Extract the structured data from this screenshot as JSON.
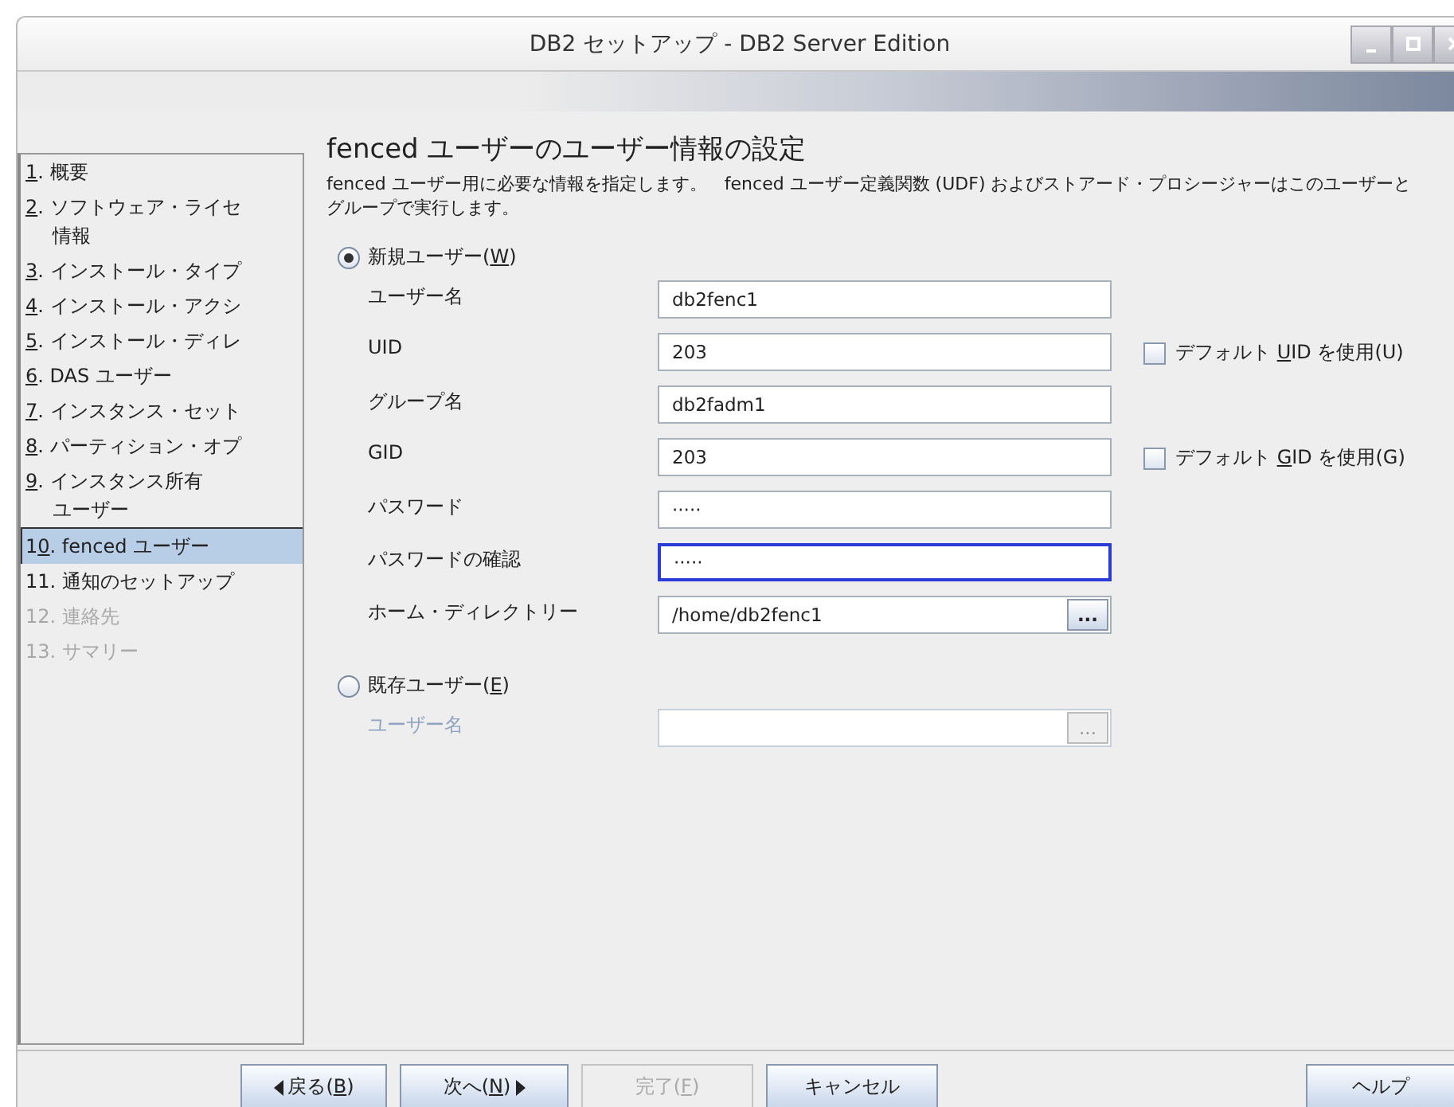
{
  "window": {
    "title": "DB2 セットアップ - DB2 Server Edition"
  },
  "steps": [
    {
      "mnemonic": "1",
      "suffix": ". 概要",
      "selected": false,
      "disabled": false
    },
    {
      "mnemonic": "2",
      "suffix": ". ソフトウェア・ライセ",
      "continuation": "情報",
      "selected": false,
      "disabled": false
    },
    {
      "mnemonic": "3",
      "suffix": ". インストール・タイプ",
      "selected": false,
      "disabled": false
    },
    {
      "mnemonic": "4",
      "suffix": ". インストール・アクシ",
      "selected": false,
      "disabled": false
    },
    {
      "mnemonic": "5",
      "suffix": ". インストール・ディレ",
      "selected": false,
      "disabled": false
    },
    {
      "mnemonic": "6",
      "suffix": ". DAS ユーザー",
      "selected": false,
      "disabled": false
    },
    {
      "mnemonic": "7",
      "suffix": ". インスタンス・セット",
      "selected": false,
      "disabled": false
    },
    {
      "mnemonic": "8",
      "suffix": ". パーティション・オプ",
      "selected": false,
      "disabled": false
    },
    {
      "mnemonic": "9",
      "suffix": ". インスタンス所有",
      "continuation": "ユーザー",
      "selected": false,
      "disabled": false
    },
    {
      "prefix": "1",
      "mnemonic": "0",
      "suffix": ". fenced ユーザー",
      "selected": true,
      "disabled": false
    },
    {
      "prefix": "11. 通知のセットアップ",
      "selected": false,
      "disabled": false
    },
    {
      "prefix": "12. 連絡先",
      "selected": false,
      "disabled": true
    },
    {
      "prefix": "13. サマリー",
      "selected": false,
      "disabled": true
    }
  ],
  "panel": {
    "heading": "fenced ユーザーのユーザー情報の設定",
    "description": "fenced ユーザー用に必要な情報を指定します。　fenced ユーザー定義関数 (UDF) およびストアード・プロシージャーはこのユーザーとグループで実行します。",
    "options": [
      {
        "prefix": "新規ユーザー(",
        "mnemonic": "W",
        "suffix": ")",
        "selected": true,
        "fields": [
          {
            "kind": "text",
            "label": "ユーザー名",
            "value": "db2fenc1",
            "focused": false,
            "disabled": false
          },
          {
            "kind": "text",
            "label": "UID",
            "value": "203",
            "focused": false,
            "disabled": false,
            "checkbox": {
              "prefix": "デフォルト ",
              "mnemonic": "U",
              "suffix": "ID を使用(U)",
              "checked": false
            }
          },
          {
            "kind": "text",
            "label": "グループ名",
            "value": "db2fadm1",
            "focused": false,
            "disabled": false
          },
          {
            "kind": "text",
            "label": "GID",
            "value": "203",
            "focused": false,
            "disabled": false,
            "checkbox": {
              "prefix": "デフォルト ",
              "mnemonic": "G",
              "suffix": "ID を使用(G)",
              "checked": false
            }
          },
          {
            "kind": "text",
            "label": "パスワード",
            "value": "·····",
            "focused": false,
            "disabled": false
          },
          {
            "kind": "text",
            "label": "パスワードの確認",
            "value": "·····",
            "focused": true,
            "disabled": false
          },
          {
            "kind": "browse",
            "label": "ホーム・ディレクトリー",
            "value": "/home/db2fenc1",
            "button": "...",
            "focused": false,
            "disabled": false
          }
        ]
      },
      {
        "prefix": "既存ユーザー(",
        "mnemonic": "E",
        "suffix": ")",
        "selected": false,
        "fields": [
          {
            "kind": "browse",
            "label": "ユーザー名",
            "button": "...",
            "focused": false,
            "disabled": true
          }
        ]
      }
    ]
  },
  "buttons": [
    {
      "kind": "back",
      "prefix": "戻る(",
      "mnemonic": "B",
      "suffix": ")",
      "disabled": false
    },
    {
      "kind": "next",
      "prefix": "次へ(",
      "mnemonic": "N",
      "suffix": ")",
      "disabled": false
    },
    {
      "kind": "plain",
      "prefix": "完了(",
      "mnemonic": "F",
      "suffix": ")",
      "disabled": true
    },
    {
      "kind": "plain",
      "prefix": "キャンセル",
      "disabled": false
    },
    {
      "kind": "help",
      "prefix": "ヘルプ",
      "disabled": false
    }
  ]
}
